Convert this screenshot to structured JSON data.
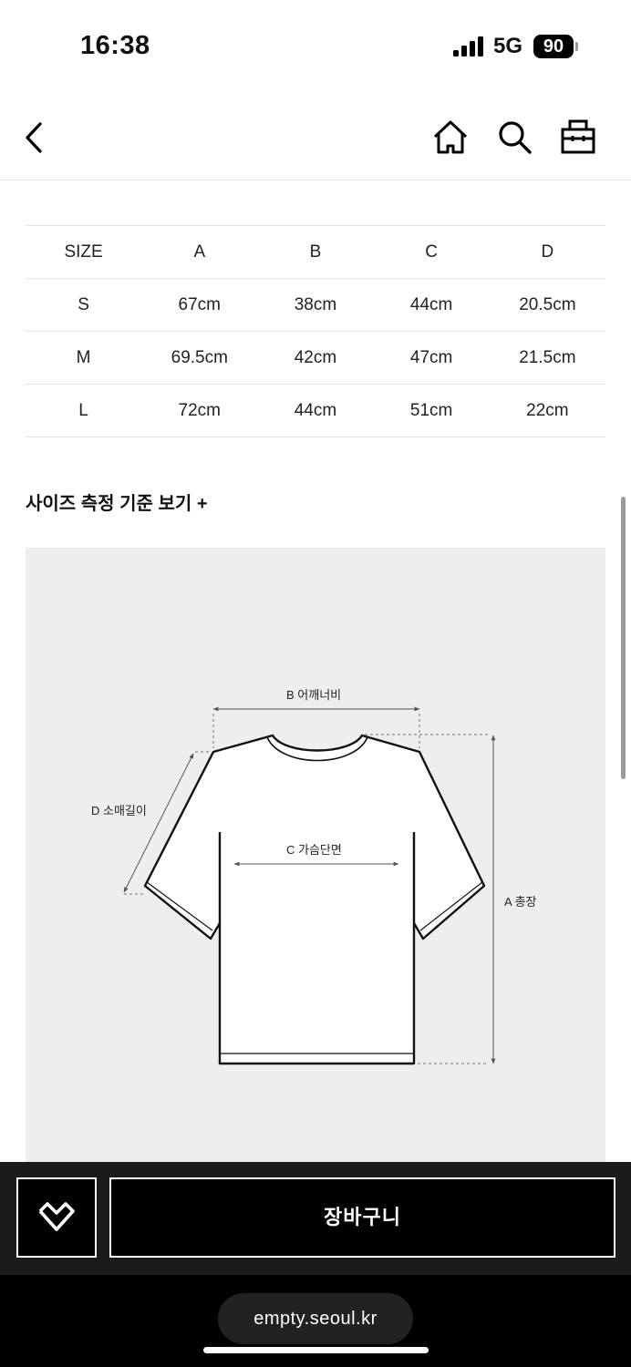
{
  "status": {
    "time": "16:38",
    "network": "5G",
    "battery": "90"
  },
  "nav": {
    "icons": [
      "back-icon",
      "home-icon",
      "search-icon",
      "bag-icon"
    ]
  },
  "size_table": {
    "headers": [
      "SIZE",
      "A",
      "B",
      "C",
      "D"
    ],
    "rows": [
      [
        "S",
        "67cm",
        "38cm",
        "44cm",
        "20.5cm"
      ],
      [
        "M",
        "69.5cm",
        "42cm",
        "47cm",
        "21.5cm"
      ],
      [
        "L",
        "72cm",
        "44cm",
        "51cm",
        "22cm"
      ]
    ]
  },
  "guide": {
    "toggle_label": "사이즈 측정 기준 보기 +"
  },
  "diagram": {
    "shoulder_label": "B 어깨너비",
    "sleeve_label": "D 소매길이",
    "chest_label": "C 가슴단면",
    "length_label": "A 총장"
  },
  "action_bar": {
    "cart_label": "장바구니",
    "wish_icon": "heart-icon"
  },
  "browser": {
    "url": "empty.seoul.kr"
  },
  "colors": {
    "background": "#ffffff",
    "diagram_bg": "#eeeeee",
    "action_bar_bg": "#1b1b1b",
    "button_bg": "#000000"
  }
}
